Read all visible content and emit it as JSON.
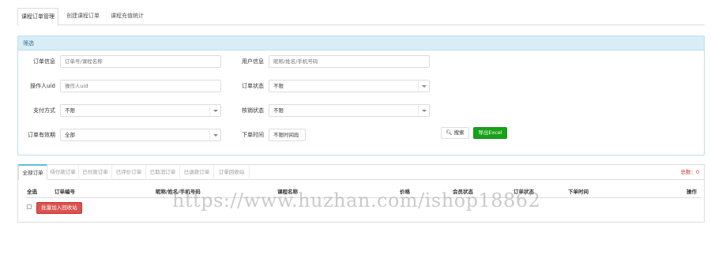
{
  "top_tabs": [
    {
      "label": "课程订单管理",
      "active": true
    },
    {
      "label": "创建课程订单",
      "active": false
    },
    {
      "label": "课程充值统计",
      "active": false
    }
  ],
  "filter": {
    "title": "筛选",
    "order_info": {
      "label": "订单信息",
      "placeholder": "订单号/课程名称"
    },
    "user_info": {
      "label": "用户信息",
      "placeholder": "昵称/姓名/手机号码"
    },
    "operator": {
      "label": "操作人uid",
      "placeholder": "操作人uid"
    },
    "order_status": {
      "label": "订单状态",
      "value": "不限"
    },
    "pay_method": {
      "label": "支付方式",
      "value": "不限"
    },
    "verify_status": {
      "label": "核销状态",
      "value": "不限"
    },
    "validity": {
      "label": "订单有效期",
      "value": "全部"
    },
    "order_time": {
      "label": "下单时间",
      "value": "不限时间段"
    },
    "search_button": "搜索",
    "export_button": "导出Excel"
  },
  "order_tabs": [
    {
      "label": "全部订单",
      "active": true
    },
    {
      "label": "待付款订单",
      "active": false
    },
    {
      "label": "已付款订单",
      "active": false
    },
    {
      "label": "已评价订单",
      "active": false
    },
    {
      "label": "已取消订单",
      "active": false
    },
    {
      "label": "已退款订单",
      "active": false
    },
    {
      "label": "订单回收站",
      "active": false
    }
  ],
  "total": "总数：0",
  "columns": [
    "全选",
    "订单编号",
    "昵称/姓名/手机号码",
    "课程名称",
    "价格",
    "会员状态",
    "订单状态",
    "下单时间",
    "操作"
  ],
  "batch_button": "批量加入回收站",
  "watermark": "https://www.huzhan.com/ishop18862",
  "colors": {
    "accent": "#5bc0de",
    "export": "#16a116",
    "danger": "#d9534f",
    "panel_head": "#d9edf7"
  }
}
